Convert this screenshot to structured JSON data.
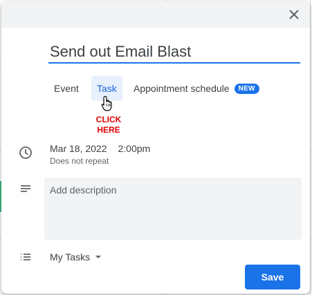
{
  "task": {
    "title_value": "Send out Email Blast",
    "tabs": [
      {
        "label": "Event",
        "active": false
      },
      {
        "label": "Task",
        "active": true
      },
      {
        "label": "Appointment schedule",
        "active": false,
        "badge": "NEW"
      }
    ],
    "annotation": {
      "line1": "CLICK",
      "line2": "HERE"
    },
    "date": "Mar 18, 2022",
    "time": "2:00pm",
    "repeat": "Does not repeat",
    "description_placeholder": "Add description",
    "task_list": "My Tasks",
    "save_label": "Save"
  },
  "icons": {
    "close": "close-icon",
    "time": "clock-icon",
    "description": "notes-icon",
    "tasklist": "list-icon",
    "cursor": "hand-pointer-icon"
  },
  "colors": {
    "accent": "#1a73e8",
    "active_tab_bg": "#e8f0fe",
    "annotation": "#e00000"
  }
}
